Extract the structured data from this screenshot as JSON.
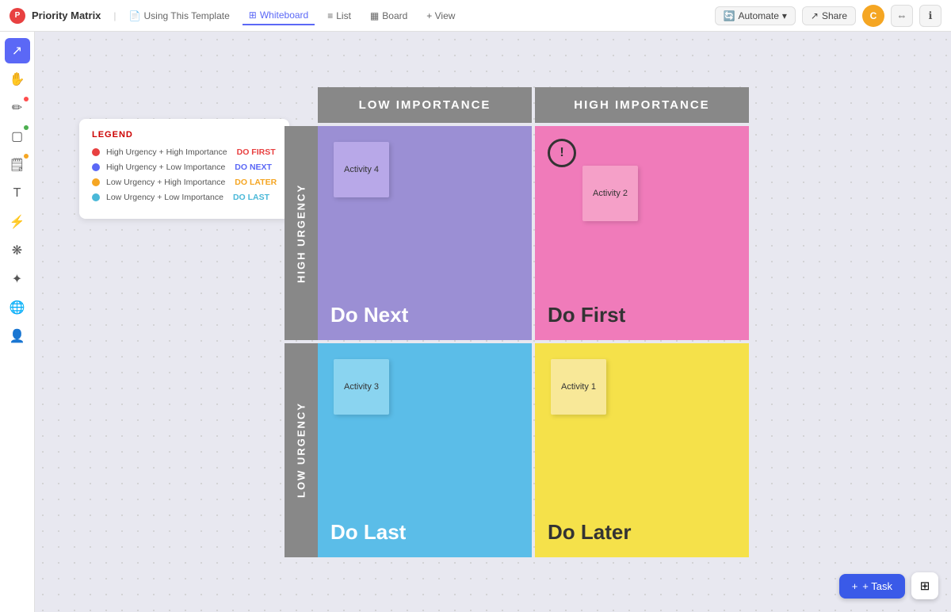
{
  "topbar": {
    "logo_text": "P",
    "title": "Priority Matrix",
    "template_label": "Using This Template",
    "whiteboard_label": "Whiteboard",
    "list_label": "List",
    "board_label": "Board",
    "view_label": "+ View",
    "automate_label": "Automate",
    "share_label": "Share",
    "avatar_letter": "C"
  },
  "legend": {
    "title": "LEGEND",
    "items": [
      {
        "color": "#e84040",
        "label": "High Urgency + High Importance",
        "action": "DO FIRST",
        "action_class": "action-first"
      },
      {
        "color": "#5b68f6",
        "label": "High Urgency + Low Importance",
        "action": "DO NEXT",
        "action_class": "action-next"
      },
      {
        "color": "#f5a623",
        "label": "Low Urgency + High Importance",
        "action": "DO LATER",
        "action_class": "action-later"
      },
      {
        "color": "#4ab8d8",
        "label": "Low Urgency + Low Importance",
        "action": "DO LAST",
        "action_class": "action-last"
      }
    ]
  },
  "matrix": {
    "col_headers": [
      "LOW IMPORTANCE",
      "HIGH IMPORTANCE"
    ],
    "row_headers": [
      "HIGH URGENCY",
      "LOW URGENCY"
    ],
    "cells": [
      {
        "id": "top-left",
        "bg": "cell-purple",
        "label": "Do Next",
        "sticky": {
          "text": "Activity 4",
          "bg": "sticky-purple"
        },
        "alert": false
      },
      {
        "id": "top-right",
        "bg": "cell-pink",
        "label": "Do First",
        "sticky": {
          "text": "Activity 2",
          "bg": "sticky-pink"
        },
        "alert": true
      },
      {
        "id": "bottom-left",
        "bg": "cell-blue",
        "label": "Do Last",
        "sticky": {
          "text": "Activity 3",
          "bg": "sticky-blue"
        },
        "alert": false
      },
      {
        "id": "bottom-right",
        "bg": "cell-yellow",
        "label": "Do Later",
        "sticky": {
          "text": "Activity 1",
          "bg": "sticky-yellow"
        },
        "alert": false
      }
    ]
  },
  "toolbar": {
    "tools": [
      {
        "name": "cursor",
        "symbol": "↗",
        "active": true
      },
      {
        "name": "hand",
        "symbol": "✋",
        "active": false
      },
      {
        "name": "pen",
        "symbol": "✏️",
        "active": false,
        "dot": "#ff4d4d"
      },
      {
        "name": "shape",
        "symbol": "□",
        "active": false,
        "dot": "#4caf50"
      },
      {
        "name": "sticky",
        "symbol": "🗒",
        "active": false,
        "dot": "#f5a623"
      },
      {
        "name": "text",
        "symbol": "T",
        "active": false
      },
      {
        "name": "highlight",
        "symbol": "⚡",
        "active": false
      },
      {
        "name": "template",
        "symbol": "❋",
        "active": false
      },
      {
        "name": "ai",
        "symbol": "✦",
        "active": false
      },
      {
        "name": "globe",
        "symbol": "🌐",
        "active": false
      },
      {
        "name": "people",
        "symbol": "👤",
        "active": false
      }
    ]
  },
  "bottom": {
    "task_label": "+ Task",
    "grid_label": "⊞"
  }
}
